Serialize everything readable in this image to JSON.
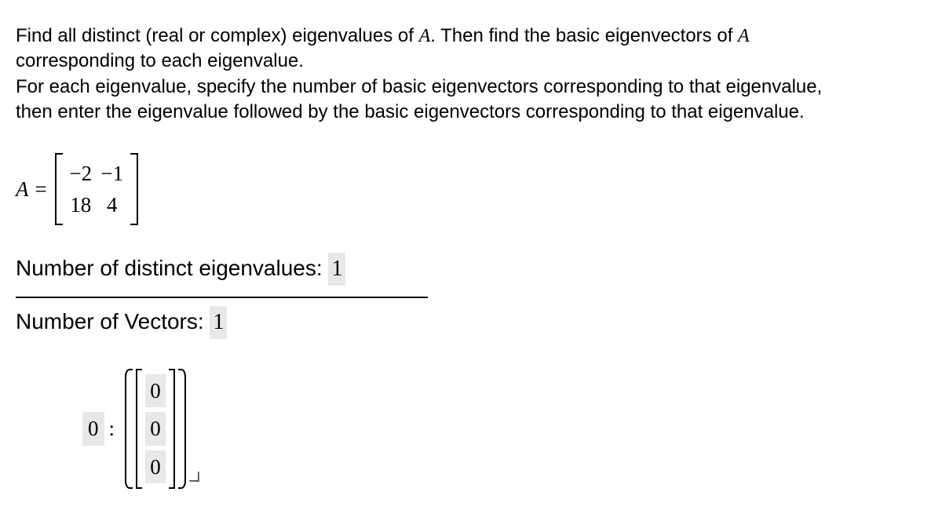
{
  "problem": {
    "line1_part1": "Find all distinct (real or complex) eigenvalues of ",
    "line1_var1": "A",
    "line1_part2": ". Then find the basic eigenvectors of ",
    "line1_var2": "A",
    "line2": "corresponding to each eigenvalue.",
    "line3": "For each eigenvalue, specify the number of basic eigenvectors corresponding to that eigenvalue,",
    "line4": "then enter the eigenvalue followed by the basic eigenvectors corresponding to that eigenvalue."
  },
  "matrix": {
    "label": "A",
    "equals": "=",
    "rows": [
      [
        "−2",
        "−1"
      ],
      [
        "18",
        "4"
      ]
    ]
  },
  "fields": {
    "distinct_label": "Number of distinct eigenvalues: ",
    "distinct_value": "1",
    "vectors_label": "Number of Vectors: ",
    "vectors_value": "1"
  },
  "eigensection": {
    "eigenvalue": "0",
    "colon": ":",
    "vector": [
      "0",
      "0",
      "0"
    ]
  }
}
